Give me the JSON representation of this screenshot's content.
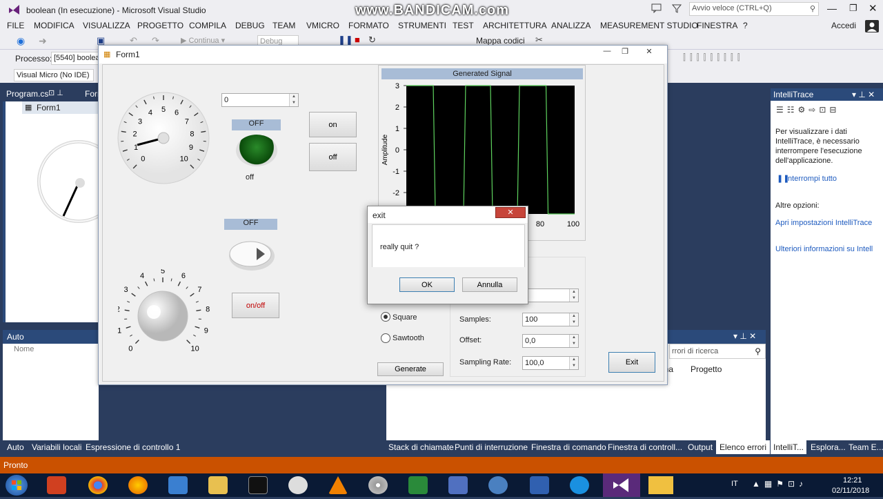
{
  "vs": {
    "title": "boolean (In esecuzione) - Microsoft Visual Studio",
    "watermark": "www.BANDICAM.com",
    "quick_launch_placeholder": "Avvio veloce (CTRL+Q)",
    "signin": "Accedi",
    "menu": [
      "FILE",
      "MODIFICA",
      "VISUALIZZA",
      "PROGETTO",
      "COMPILA",
      "DEBUG",
      "TEAM",
      "VMICRO",
      "FORMATO",
      "STRUMENTI",
      "TEST",
      "ARCHITETTURA",
      "ANALIZZA",
      "MEASUREMENT STUDIO",
      "FINESTRA",
      "?"
    ],
    "toolbar": {
      "continue_label": "Continua",
      "config_label": "Debug",
      "codemap_label": "Mappa codici",
      "process_label": "Processo:",
      "process_value": "[5540] boolea",
      "board_value": "Visual Micro (No IDE)"
    },
    "doc_tabs": {
      "program": "Program.cs",
      "form_short": "Forn"
    },
    "solution_item": "Form1",
    "auto_panel": {
      "title": "Auto",
      "col_name": "Nome"
    },
    "left_bottom_tabs": [
      "Auto",
      "Variabili locali",
      "Espressione di controllo 1"
    ],
    "right_bottom_tabs": [
      "Stack di chiamate",
      "Punti di interruzione",
      "Finestra di comando",
      "Finestra di controll...",
      "Output",
      "Elenco errori"
    ],
    "error_list": {
      "search_placeholder": "rrori di ricerca",
      "col_a": "ina",
      "col_b": "Progetto"
    },
    "intellitrace": {
      "title": "IntelliTrace",
      "message": "Per visualizzare i dati IntelliTrace, è necessario interrompere l'esecuzione dell'applicazione.",
      "break_all": "Interrompi tutto",
      "other_options": "Altre opzioni:",
      "open_settings": "Apri impostazioni IntelliTrace",
      "more_info": "Ulteriori informazioni su Intell",
      "tabs": [
        "IntelliT...",
        "Esplora...",
        "Team E..."
      ]
    },
    "status": "Pronto",
    "taskbar": {
      "lang": "IT",
      "time": "12:21",
      "date": "02/11/2018"
    }
  },
  "form1": {
    "title": "Form1",
    "numeric_top": "0",
    "led1": {
      "label": "OFF",
      "caption": "off"
    },
    "led2": {
      "label": "OFF"
    },
    "btn_on": "on",
    "btn_off": "off",
    "btn_onoff": "on/off",
    "gauge_ticks": [
      "0",
      "1",
      "2",
      "3",
      "4",
      "5",
      "6",
      "7",
      "8",
      "9",
      "10"
    ],
    "knob_ticks": [
      "0",
      "1",
      "2",
      "3",
      "4",
      "5",
      "6",
      "7",
      "8",
      "9",
      "10"
    ],
    "graph": {
      "title": "Generated Signal",
      "ylabel": "Amplitude",
      "yticks": [
        "3",
        "2",
        "1",
        "0",
        "-1",
        "-2"
      ],
      "xticks_visible": [
        "80",
        "100"
      ]
    },
    "radio_square": "Square",
    "radio_sawtooth": "Sawtooth",
    "samples_label": "Samples:",
    "samples_value": "100",
    "offset_label": "Offset:",
    "offset_value": "0,0",
    "rate_label": "Sampling Rate:",
    "rate_value": "100,0",
    "hidden_field_1": ",0",
    "generate": "Generate",
    "exit": "Exit"
  },
  "dialog": {
    "title": "exit",
    "message": "really quit ?",
    "ok": "OK",
    "cancel": "Annulla"
  },
  "colors": {
    "vs_accent": "#2b4a7a",
    "status": "#ca5100",
    "signal": "#5fd45f",
    "graph_bg": "#000000"
  }
}
